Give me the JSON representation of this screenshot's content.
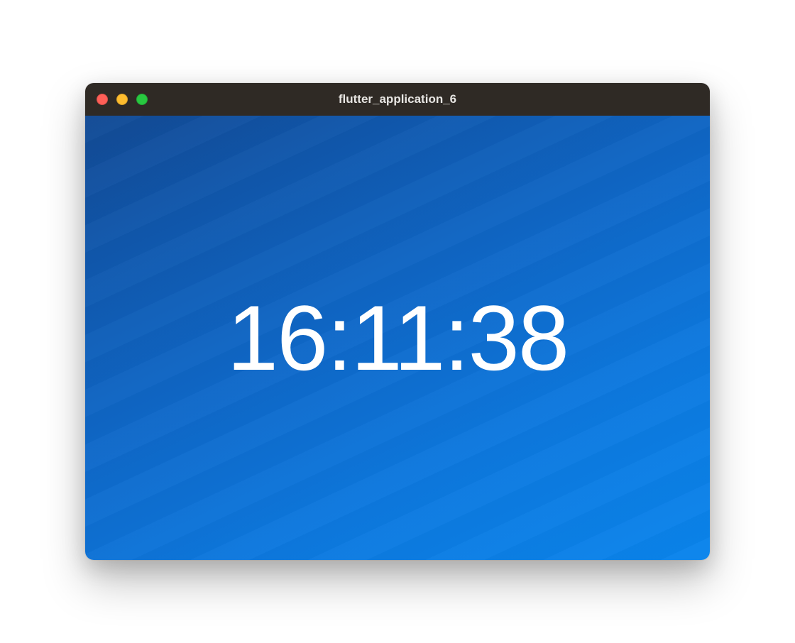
{
  "window": {
    "title": "flutter_application_6"
  },
  "clock": {
    "time": "16:11:38"
  }
}
